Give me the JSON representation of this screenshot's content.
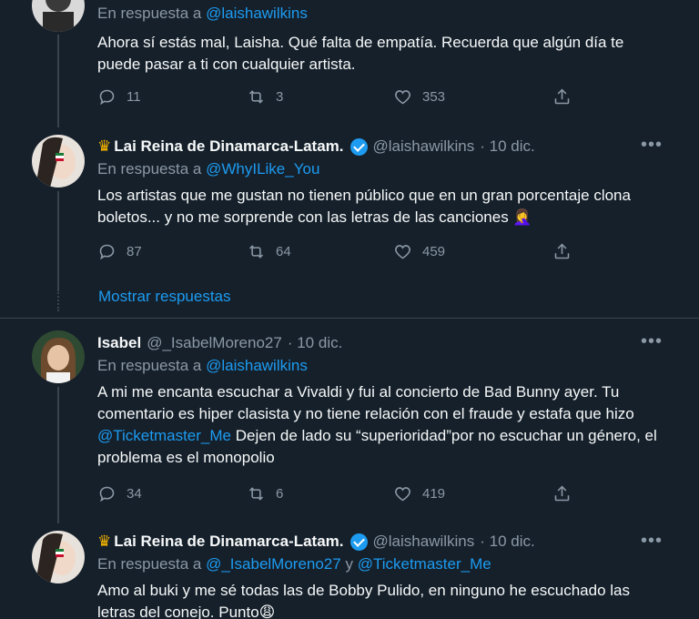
{
  "tweets": [
    {
      "reply_prefix": "En respuesta a",
      "reply_to": "@laishawilkins",
      "text": "Ahora sí estás mal, Laisha. Qué falta de empatía. Recuerda que algún día te puede pasar a ti con cualquier artista.",
      "replies": "11",
      "retweets": "3",
      "likes": "353"
    },
    {
      "name": "Lai Reina de Dinamarca-Latam.",
      "handle": "@laishawilkins",
      "date": "· 10 dic.",
      "reply_prefix": "En respuesta a",
      "reply_to": "@WhyILike_You",
      "text": "Los artistas que me gustan no tienen público que en un gran porcentaje clona boletos... y no me sorprende con las letras de las canciones 🤦‍♀️",
      "replies": "87",
      "retweets": "64",
      "likes": "459"
    },
    {
      "name": "Isabel",
      "handle": "@_IsabelMoreno27",
      "date": "· 10 dic.",
      "reply_prefix": "En respuesta a",
      "reply_to": "@laishawilkins",
      "text_before": "A mi me encanta escuchar a Vivaldi y fui al concierto de Bad Bunny ayer. Tu comentario es hiper clasista y no tiene relación con el fraude y estafa que hizo ",
      "text_mention": "@Ticketmaster_Me",
      "text_after": " Dejen de lado su “superioridad”por no escuchar un género, el problema es el monopolio",
      "replies": "34",
      "retweets": "6",
      "likes": "419"
    },
    {
      "name": "Lai Reina de Dinamarca-Latam.",
      "handle": "@laishawilkins",
      "date": "· 10 dic.",
      "reply_prefix": "En respuesta a",
      "reply_to_1": "@_IsabelMoreno27",
      "reply_join": "y",
      "reply_to_2": "@Ticketmaster_Me",
      "text": "Amo al buki y me sé todas las de Bobby Pulido, en ninguno he escuchado las letras del conejo. Punto😩"
    }
  ],
  "show_replies": "Mostrar respuestas",
  "icons": {
    "reply": "reply-icon",
    "retweet": "retweet-icon",
    "like": "heart-icon",
    "share": "share-icon",
    "verified": "verified-icon",
    "crown": "crown-icon"
  },
  "colors": {
    "background": "#15202b",
    "accent": "#1d9bf0",
    "secondary_text": "#8b98a5",
    "divider": "#38444d"
  }
}
